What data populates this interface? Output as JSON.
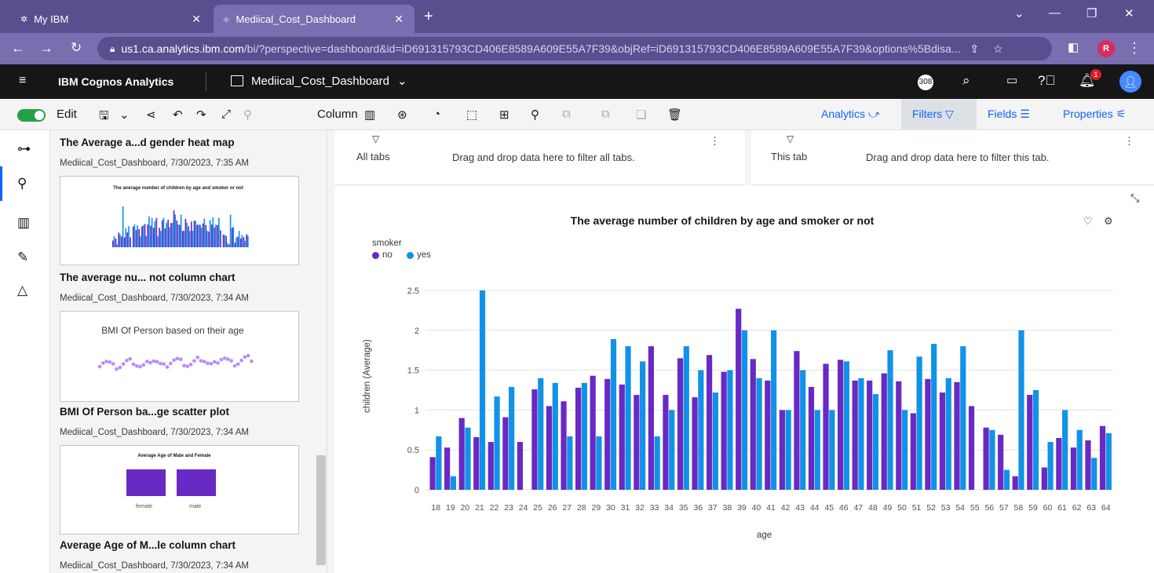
{
  "browser": {
    "tabs": [
      {
        "title": "My IBM"
      },
      {
        "title": "Mediical_Cost_Dashboard"
      }
    ],
    "url_host": "us1.ca.analytics.ibm.com",
    "url_path": "/bi/?perspective=dashboard&id=iD691315793CD406E8589A609E55A7F39&objRef=iD691315793CD406E8589A609E55A7F39&options%5Bdisa...",
    "profile_initial": "R"
  },
  "app": {
    "brand": "IBM Cognos Analytics",
    "dashboard_name": "Mediical_Cost_Dashboard",
    "badge_count": "308",
    "notification_count": "1"
  },
  "toolbar": {
    "edit_label": "Edit",
    "column_label": "Column",
    "analytics_label": "Analytics",
    "filters_label": "Filters",
    "fields_label": "Fields",
    "properties_label": "Properties"
  },
  "panel": {
    "cards": [
      {
        "title": "The Average a...d gender heat map",
        "sub": "Mediical_Cost_Dashboard, 7/30/2023, 7:35 AM",
        "thumb_title": "The average number of children by age and smoker or not"
      },
      {
        "title": "The average nu... not column chart",
        "sub": "Mediical_Cost_Dashboard, 7/30/2023, 7:34 AM",
        "thumb_title": "BMI Of Person based on their age"
      },
      {
        "title": "BMI Of Person ba...ge scatter plot",
        "sub": "Mediical_Cost_Dashboard, 7/30/2023, 7:34 AM",
        "thumb_title": "Average Age of Male and Female"
      },
      {
        "title": "Average Age of M...le column chart",
        "sub": "Mediical_Cost_Dashboard, 7/30/2023, 7:34 AM"
      }
    ],
    "thumb3_labels": [
      "female",
      "male"
    ]
  },
  "filters": {
    "all_tabs_label": "All tabs",
    "all_tabs_hint": "Drag and drop data here to filter all tabs.",
    "this_tab_label": "This tab",
    "this_tab_hint": "Drag and drop data here to filter this tab."
  },
  "colors": {
    "no": "#6929c4",
    "yes": "#1192e8"
  },
  "chart_data": {
    "type": "bar",
    "title": "The average number of children by age and smoker or not",
    "xlabel": "age",
    "ylabel": "children (Average)",
    "legend_title": "smoker",
    "legend_position": "top-left",
    "ylim": [
      0,
      2.5
    ],
    "yticks": [
      "0",
      "0.5",
      "1",
      "1.5",
      "2",
      "2.5"
    ],
    "grid": true,
    "categories": [
      "18",
      "19",
      "20",
      "21",
      "22",
      "23",
      "24",
      "25",
      "26",
      "27",
      "28",
      "29",
      "30",
      "31",
      "32",
      "33",
      "34",
      "35",
      "36",
      "37",
      "38",
      "39",
      "40",
      "41",
      "42",
      "43",
      "44",
      "45",
      "46",
      "47",
      "48",
      "49",
      "50",
      "51",
      "52",
      "53",
      "54",
      "55",
      "56",
      "57",
      "58",
      "59",
      "60",
      "61",
      "62",
      "63",
      "64"
    ],
    "series": [
      {
        "name": "no",
        "values": [
          0.41,
          0.53,
          0.9,
          0.66,
          0.6,
          0.91,
          0.6,
          1.26,
          1.05,
          1.11,
          1.28,
          1.43,
          1.39,
          1.32,
          1.19,
          1.8,
          1.19,
          1.65,
          1.16,
          1.69,
          1.48,
          2.27,
          1.64,
          1.37,
          1.0,
          1.74,
          1.29,
          1.58,
          1.63,
          1.37,
          1.37,
          1.46,
          1.36,
          0.96,
          1.39,
          1.22,
          1.35,
          1.05,
          0.78,
          0.69,
          0.17,
          1.19,
          0.28,
          0.65,
          0.53,
          0.62,
          0.8
        ]
      },
      {
        "name": "yes",
        "values": [
          0.67,
          0.17,
          0.78,
          2.5,
          1.17,
          1.29,
          0,
          1.4,
          1.34,
          0.67,
          1.34,
          0.67,
          1.89,
          1.8,
          1.61,
          0.67,
          1.0,
          1.8,
          1.5,
          1.22,
          1.5,
          2.0,
          1.4,
          2.0,
          1.0,
          1.5,
          1.0,
          1.0,
          1.61,
          1.4,
          1.2,
          1.75,
          1.0,
          1.67,
          1.83,
          1.4,
          1.8,
          0,
          0.75,
          0.25,
          2.0,
          1.25,
          0.6,
          1.0,
          0.75,
          0.4,
          0.71
        ]
      }
    ]
  }
}
